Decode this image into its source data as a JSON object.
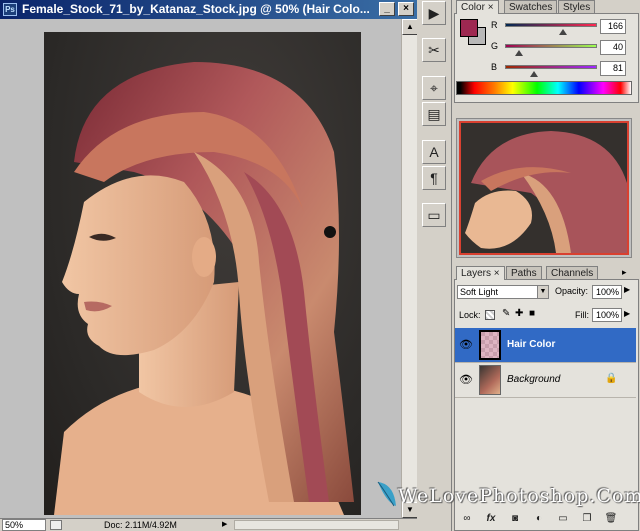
{
  "document": {
    "title": "Female_Stock_71_by_Katanaz_Stock.jpg @ 50% (Hair Colo...",
    "app_icon_text": "Ps",
    "minimize_symbol": "_",
    "close_symbol": "×"
  },
  "status": {
    "zoom": "50%",
    "doc_info": "Doc: 2.11M/4.92M"
  },
  "toolbar": {
    "tools": [
      "play-icon",
      "brush-tools-icon",
      "path-select-icon",
      "notes-icon",
      "type-icon",
      "paragraph-icon",
      "panel-toggle-icon"
    ]
  },
  "color_panel": {
    "tabs": [
      "Color",
      "Swatches",
      "Styles"
    ],
    "close_symbol": "×",
    "foreground_color": "#9e2851",
    "r_label": "R",
    "r_value": "166",
    "g_label": "G",
    "g_value": "40",
    "b_label": "B",
    "b_value": "81"
  },
  "layers_panel": {
    "tabs": [
      "Layers",
      "Paths",
      "Channels"
    ],
    "close_symbol": "×",
    "blend_mode": "Soft Light",
    "opacity_label": "Opacity:",
    "opacity_value": "100%",
    "lock_label": "Lock:",
    "fill_label": "Fill:",
    "fill_value": "100%",
    "layers": [
      {
        "name": "Hair Color",
        "selected": true,
        "visible": true
      },
      {
        "name": "Background",
        "selected": false,
        "visible": true,
        "locked": true
      }
    ],
    "selection_color": "#316ac5"
  },
  "watermark": "WeLovePhotoshop.Com"
}
